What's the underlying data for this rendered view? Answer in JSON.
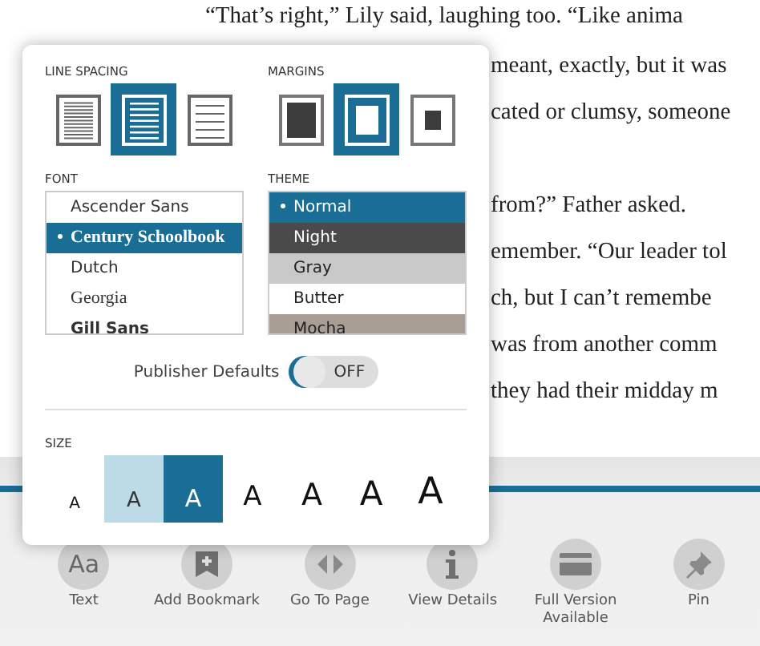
{
  "book": {
    "paragraphs": [
      {
        "lines": [
          "“That’s right,” Lily said, laughing too. “Like anima",
          "meant, exactly, but it was",
          "cated or clumsy, someone"
        ]
      },
      {
        "lines": [
          "from?” Father asked.",
          "emember. “Our leader tol",
          "ch, but I can’t remembe",
          "was from another comm",
          "they had their midday m"
        ]
      }
    ],
    "progress": {
      "level": 1
    }
  },
  "panel": {
    "line_spacing": {
      "label": "LINE SPACING",
      "options": [
        {
          "kind": "tight",
          "selected": false
        },
        {
          "kind": "medium",
          "selected": true
        },
        {
          "kind": "loose",
          "selected": false
        }
      ]
    },
    "margins": {
      "label": "MARGINS",
      "options": [
        {
          "kind": "small",
          "selected": false
        },
        {
          "kind": "medium",
          "selected": true
        },
        {
          "kind": "large",
          "selected": false
        }
      ]
    },
    "font": {
      "label": "FONT",
      "items": [
        {
          "name": "Ascender Sans",
          "kind": "sans",
          "selected": false
        },
        {
          "name": "Century Schoolbook",
          "kind": "serif-bold",
          "selected": true
        },
        {
          "name": "Dutch",
          "kind": "sans",
          "selected": false
        },
        {
          "name": "Georgia",
          "kind": "serif",
          "selected": false
        },
        {
          "name": "Gill Sans",
          "kind": "sans-bold",
          "selected": false
        }
      ]
    },
    "theme": {
      "label": "THEME",
      "items": [
        {
          "name": "Normal",
          "color": "#1a6e96",
          "selected": true
        },
        {
          "name": "Night",
          "color": "#4a4a4a",
          "selected": false
        },
        {
          "name": "Gray",
          "color": "#c9c9c9",
          "selected": false
        },
        {
          "name": "Butter",
          "color": "#ffffff",
          "selected": false
        },
        {
          "name": "Mocha",
          "color": "#a89e95",
          "selected": false
        }
      ]
    },
    "publisher_defaults": {
      "label": "Publisher Defaults",
      "on": false,
      "state_text": "OFF"
    },
    "size": {
      "label": "SIZE",
      "options": [
        {
          "text": "A",
          "highlighted": false,
          "selected": false
        },
        {
          "text": "A",
          "highlighted": true,
          "selected": false
        },
        {
          "text": "A",
          "highlighted": false,
          "selected": true
        },
        {
          "text": "A",
          "highlighted": false,
          "selected": false
        },
        {
          "text": "A",
          "highlighted": false,
          "selected": false
        },
        {
          "text": "A",
          "highlighted": false,
          "selected": false
        },
        {
          "text": "A",
          "highlighted": false,
          "selected": false
        }
      ]
    }
  },
  "toolbar": [
    {
      "kind": "text",
      "label": "Text",
      "icon_text": "Aa"
    },
    {
      "kind": "bookmark",
      "label": "Add Bookmark"
    },
    {
      "kind": "goto",
      "label": "Go To Page"
    },
    {
      "kind": "details",
      "label": "View Details"
    },
    {
      "kind": "card",
      "label": "Full Version Available"
    },
    {
      "kind": "pin",
      "label": "Pin"
    }
  ]
}
